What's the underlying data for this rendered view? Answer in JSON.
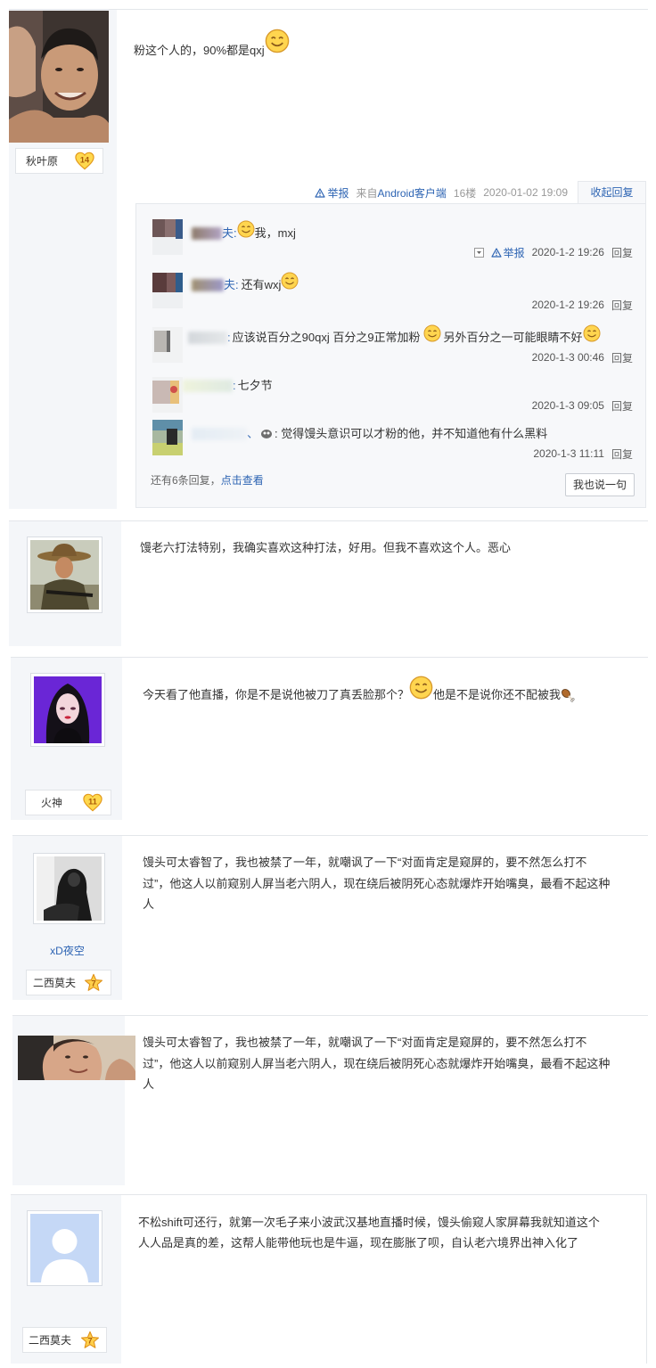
{
  "colors": {
    "link": "#2d64b3",
    "text": "#333333",
    "meta": "#999999",
    "sidebar": "#f4f6f9",
    "reply_box": "#f7f8fa",
    "level_heart": "#ffd84d",
    "level_star": "#ffcf4a"
  },
  "icons": {
    "emoji": "smiley-face",
    "report": "warning-triangle",
    "level_badge_heart": "heart",
    "level_badge_star": "star",
    "drumstick": "chicken-drumstick",
    "reply_menu": "dropdown-box"
  },
  "posts": [
    {
      "badge": {
        "title": "秋叶原",
        "level": "14"
      },
      "content": {
        "text": "粉这个人的，90%都是qxj"
      },
      "meta": {
        "report": "举报",
        "source_prefix": "来自",
        "source_link": "Android客户端",
        "floor": "16楼",
        "time": "2020-01-02 19:09",
        "collapse": "收起回复"
      },
      "replies": [
        {
          "name_tail": "夫:",
          "text": "我，mxj",
          "report": "举报",
          "time": "2020-1-2 19:26",
          "reply": "回复"
        },
        {
          "name_tail": "夫:",
          "text": "还有wxj",
          "time": "2020-1-2 19:26",
          "reply": "回复"
        },
        {
          "name_tail": ":",
          "text": "应该说百分之90qxj 百分之9正常加粉",
          "text2": "另外百分之一可能眼睛不好",
          "time": "2020-1-3 00:46",
          "reply": "回复"
        },
        {
          "name_tail": ":",
          "text": "七夕节",
          "time": "2020-1-3 09:05",
          "reply": "回复"
        },
        {
          "name_tail": "、",
          "text": ": 觉得馒头意识可以才粉的他，并不知道他有什么黑料",
          "time": "2020-1-3 11:11",
          "reply": "回复"
        }
      ],
      "more_replies": {
        "prefix": "还有6条回复，",
        "link": "点击查看"
      },
      "reply_button": "我也说一句"
    },
    {
      "content": {
        "text": "馒老六打法特别，我确实喜欢这种打法，好用。但我不喜欢这个人。恶心"
      }
    },
    {
      "badge": {
        "title": "火神",
        "level": "11"
      },
      "content": {
        "text1": "今天看了他直播，你是不是说他被刀了真丢脸那个？",
        "text2": "他是不是说你还不配被我"
      }
    },
    {
      "author": {
        "name": "xD夜空"
      },
      "badge": {
        "title": "二西莫夫",
        "level": "7"
      },
      "content": {
        "lines": [
          "馒头可太睿智了，我也被禁了一年，就嘲讽了一下“对面肯定是窥屏的，要不然怎么打不",
          "过”，他这人以前窥别人屏当老六阴人，现在绕后被阴死心态就爆炸开始嘴臭，最看不起这种",
          "人"
        ]
      }
    },
    {
      "content": {
        "lines": [
          "馒头可太睿智了，我也被禁了一年，就嘲讽了一下“对面肯定是窥屏的，要不然怎么打不",
          "过”，他这人以前窥别人屏当老六阴人，现在绕后被阴死心态就爆炸开始嘴臭，最看不起这种",
          "人"
        ]
      }
    },
    {
      "badge": {
        "title": "二西莫夫",
        "level": "7"
      },
      "content": {
        "lines": [
          "不松shift可还行，就第一次毛子来小波武汉基地直播时候，馒头偷窥人家屏幕我就知道这个",
          "人人品是真的差，这帮人能带他玩也是牛逼，现在膨胀了呗，自认老六境界出神入化了"
        ]
      }
    }
  ]
}
